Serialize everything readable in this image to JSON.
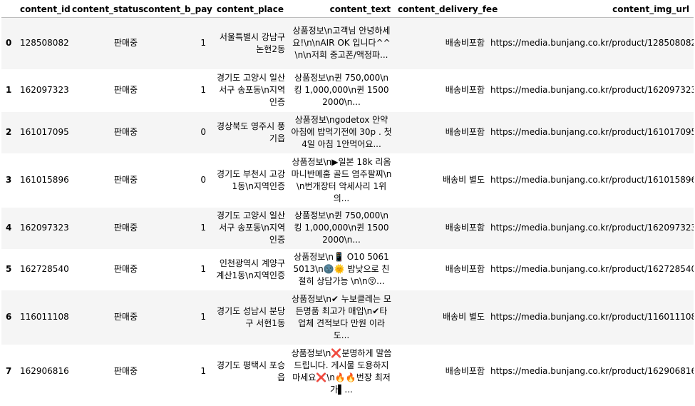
{
  "columns": [
    "",
    "content_id",
    "content_status",
    "content_b_pay",
    "content_place",
    "content_text",
    "content_delivery_fee",
    "content_img_url"
  ],
  "rows": [
    {
      "idx": "0",
      "id": "128508082",
      "status": "판매중",
      "pay": "1",
      "place": "서울특별시 강남구 논현2동",
      "text": "상품정보\\n고객님 안녕하세요!\\n\\nAIR OK 입니다^^\\n\\n저희 중고폰/액정파...",
      "fee": "배송비포함",
      "url": "https://media.bunjang.co.kr/product/128508082_..."
    },
    {
      "idx": "1",
      "id": "162097323",
      "status": "판매중",
      "pay": "1",
      "place": "경기도 고양시 일산서구 송포동\\n지역인증",
      "text": "상품정보\\n퀸 750,000\\n킹 1,000,000\\n퀸 1500 2000\\n...",
      "fee": "배송비포함",
      "url": "https://media.bunjang.co.kr/product/162097323_..."
    },
    {
      "idx": "2",
      "id": "161017095",
      "status": "판매중",
      "pay": "0",
      "place": "경상북도 영주시 풍기읍",
      "text": "상품정보\\ngodetox 안약 아침에 밥먹기전에 30p . 첫4일 아침 1안먹어요...",
      "fee": "배송비포함",
      "url": "https://media.bunjang.co.kr/product/161017095_..."
    },
    {
      "idx": "3",
      "id": "161015896",
      "status": "판매중",
      "pay": "0",
      "place": "경기도 부천시 고강1동\\n지역인증",
      "text": "상품정보\\n▶일본 18k 리옴마니반메훔 골드 염주팔찌\\n\\n번개장터 악세사리 1위의...",
      "fee": "배송비 별도",
      "url": "https://media.bunjang.co.kr/product/161015896_..."
    },
    {
      "idx": "4",
      "id": "162097323",
      "status": "판매중",
      "pay": "1",
      "place": "경기도 고양시 일산서구 송포동\\n지역인증",
      "text": "상품정보\\n퀸 750,000\\n킹 1,000,000\\n퀸 1500 2000\\n...",
      "fee": "배송비포함",
      "url": "https://media.bunjang.co.kr/product/162097323_..."
    },
    {
      "idx": "5",
      "id": "162728540",
      "status": "판매중",
      "pay": "1",
      "place": "인천광역시 계양구 계산1동\\n지역인증",
      "text": "상품정보\\n📱 O10 5061 5013\\n🌚🌞 밤낮으로 친절히 상담가능 \\n\\n😚...",
      "fee": "배송비포함",
      "url": "https://media.bunjang.co.kr/product/162728540_..."
    },
    {
      "idx": "6",
      "id": "116011108",
      "status": "판매중",
      "pay": "1",
      "place": "경기도 성남시 분당구 서현1동",
      "text": "상품정보\\n✔ 누보클레는 모든명품 최고가 매입\\n✔타 업체 견적보다 만원 이라도...",
      "fee": "배송비 별도",
      "url": "https://media.bunjang.co.kr/product/116011108_..."
    },
    {
      "idx": "7",
      "id": "162906816",
      "status": "판매중",
      "pay": "1",
      "place": "경기도 평택시 포승읍",
      "text": "상품정보\\n❌분명하게 말씀드립니다. 게시물 도용하지 마세요❌\\n🔥🔥번장 최저가▌...",
      "fee": "배송비포함",
      "url": "https://media.bunjang.co.kr/product/162906816_..."
    }
  ]
}
